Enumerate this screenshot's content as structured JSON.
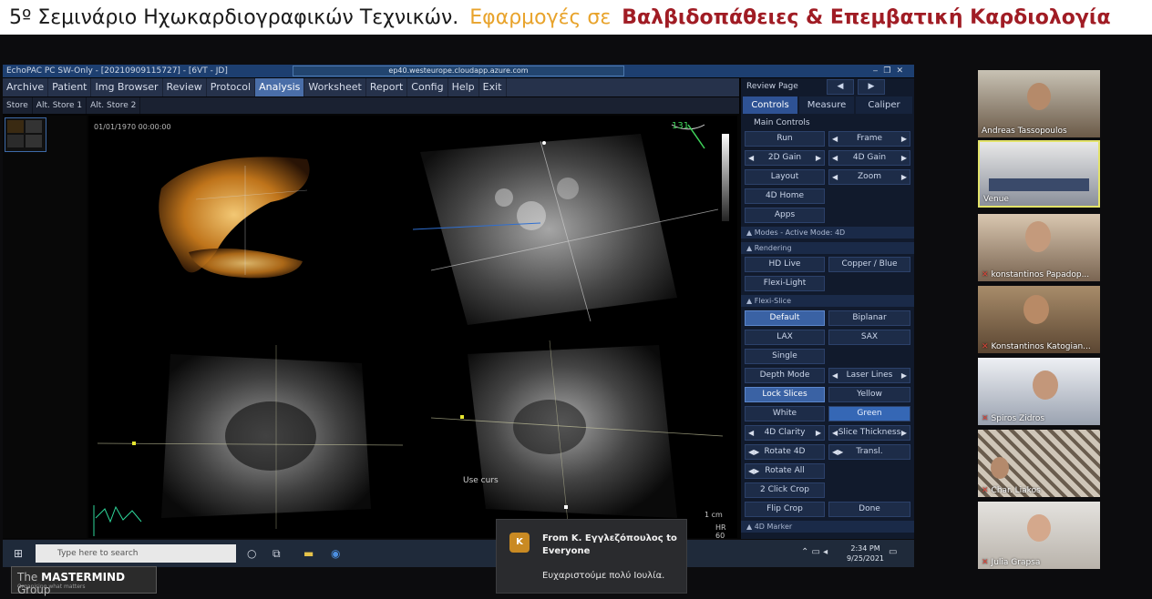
{
  "banner": {
    "part1": "5º Σεμινάριο Ηχωκαρδιογραφικών Τεχνικών.",
    "part2": "Εφαρμογές σε",
    "part3": "Βαλβιδοπάθειες & Επεμβατική Καρδιολογία"
  },
  "app": {
    "title": "EchoPAC PC SW-Only - [20210909115727] - [6VT - JD]",
    "remote_host": "ep40.westeurope.cloudapp.azure.com",
    "menu": [
      "Archive",
      "Patient",
      "Img Browser",
      "Review",
      "Protocol",
      "Analysis",
      "Worksheet",
      "Report",
      "Config",
      "Help",
      "Exit"
    ],
    "active_menu": "Analysis",
    "store": [
      "Store",
      "Alt. Store 1",
      "Alt. Store 2"
    ],
    "viewer": {
      "date": "01/01/1970 00:00:00",
      "angle": "131",
      "scale": "1 cm",
      "hr": "HR 60"
    },
    "status_hint": "Use curs"
  },
  "panel": {
    "review_page": "Review Page",
    "tabs": [
      "Controls",
      "Measure",
      "Caliper"
    ],
    "main_controls": "Main Controls",
    "run": "Run",
    "frame": "Frame",
    "gain2d": "2D Gain",
    "gain4d": "4D Gain",
    "layout": "Layout",
    "zoom": "Zoom",
    "home4d": "4D Home",
    "apps": "Apps",
    "modes": "Modes - Active Mode: 4D",
    "rendering": "Rendering",
    "hdlive": "HD Live",
    "copper": "Copper / Blue",
    "flexilight": "Flexi-Light",
    "flexislice": "Flexi-Slice",
    "default": "Default",
    "biplanar": "Biplanar",
    "lax": "LAX",
    "sax": "SAX",
    "single": "Single",
    "depthmode": "Depth Mode",
    "laserlines": "Laser Lines",
    "lockslices": "Lock Slices",
    "yellow": "Yellow",
    "white": "White",
    "green": "Green",
    "clarity4d": "4D Clarity",
    "slicethickness": "Slice Thickness",
    "rotate4d": "Rotate 4D",
    "transl": "Transl.",
    "rotateall": "Rotate All",
    "clickcrop": "2 Click Crop",
    "flipcrop": "Flip Crop",
    "done": "Done",
    "marker4d": "4D Marker"
  },
  "taskbar": {
    "search_placeholder": "Type here to search",
    "time": "2:34 PM",
    "date": "9/25/2021"
  },
  "logo": {
    "the": "The",
    "name": "MASTERMIND",
    "group": "Group",
    "tagline": "Organising what matters"
  },
  "notification": {
    "initial": "K",
    "from": "From K. Εγγλεζόπουλος to Everyone",
    "message": "Ευχαριστούμε πολύ Ιουλία."
  },
  "participants": [
    {
      "name": "Andreas Tassopoulos",
      "muted": false
    },
    {
      "name": "Venue",
      "muted": false
    },
    {
      "name": "konstantinos Papadop...",
      "muted": true
    },
    {
      "name": "Konstantinos Katogian...",
      "muted": true
    },
    {
      "name": "Spiros Zidros",
      "muted": true
    },
    {
      "name": "Char. Liakos",
      "muted": true
    },
    {
      "name": "Julia Grapsa",
      "muted": true
    }
  ]
}
